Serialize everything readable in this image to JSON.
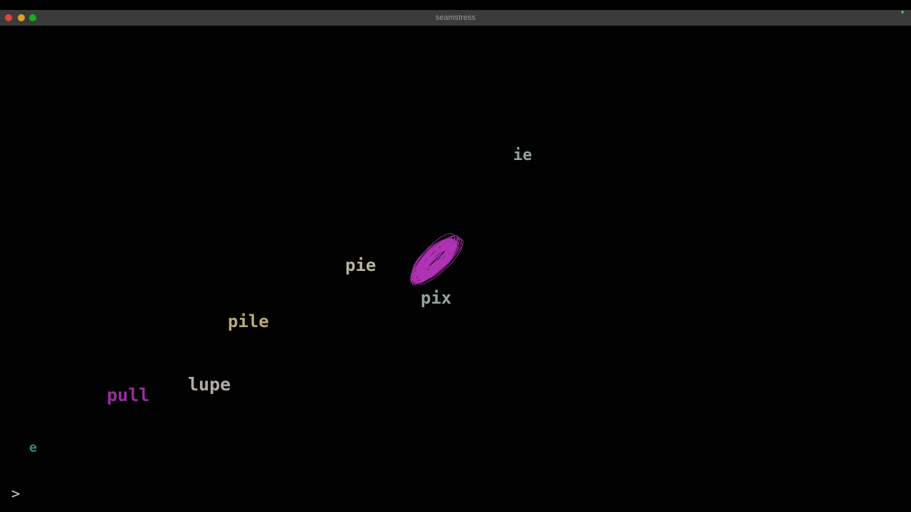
{
  "window": {
    "title": "seamstress",
    "controls": {
      "close_color": "#e0443e",
      "minimize_color": "#dea123",
      "zoom_color": "#1aab29"
    },
    "status_dot_color": "#26c84a"
  },
  "canvas": {
    "words": [
      {
        "id": "ie",
        "text": "ie",
        "color": "#8fa39f"
      },
      {
        "id": "pie",
        "text": "pie",
        "color": "#b7b59a"
      },
      {
        "id": "pix",
        "text": "pix",
        "color": "#8fa39f"
      },
      {
        "id": "pile",
        "text": "pile",
        "color": "#bba877"
      },
      {
        "id": "lupe",
        "text": "lupe",
        "color": "#b4a9a6"
      },
      {
        "id": "pull",
        "text": "pull",
        "color": "#9a2c9f"
      },
      {
        "id": "e",
        "text": "e",
        "color": "#2f8a82"
      }
    ],
    "scribble_color": "#c43ac9",
    "prompt": ">"
  }
}
